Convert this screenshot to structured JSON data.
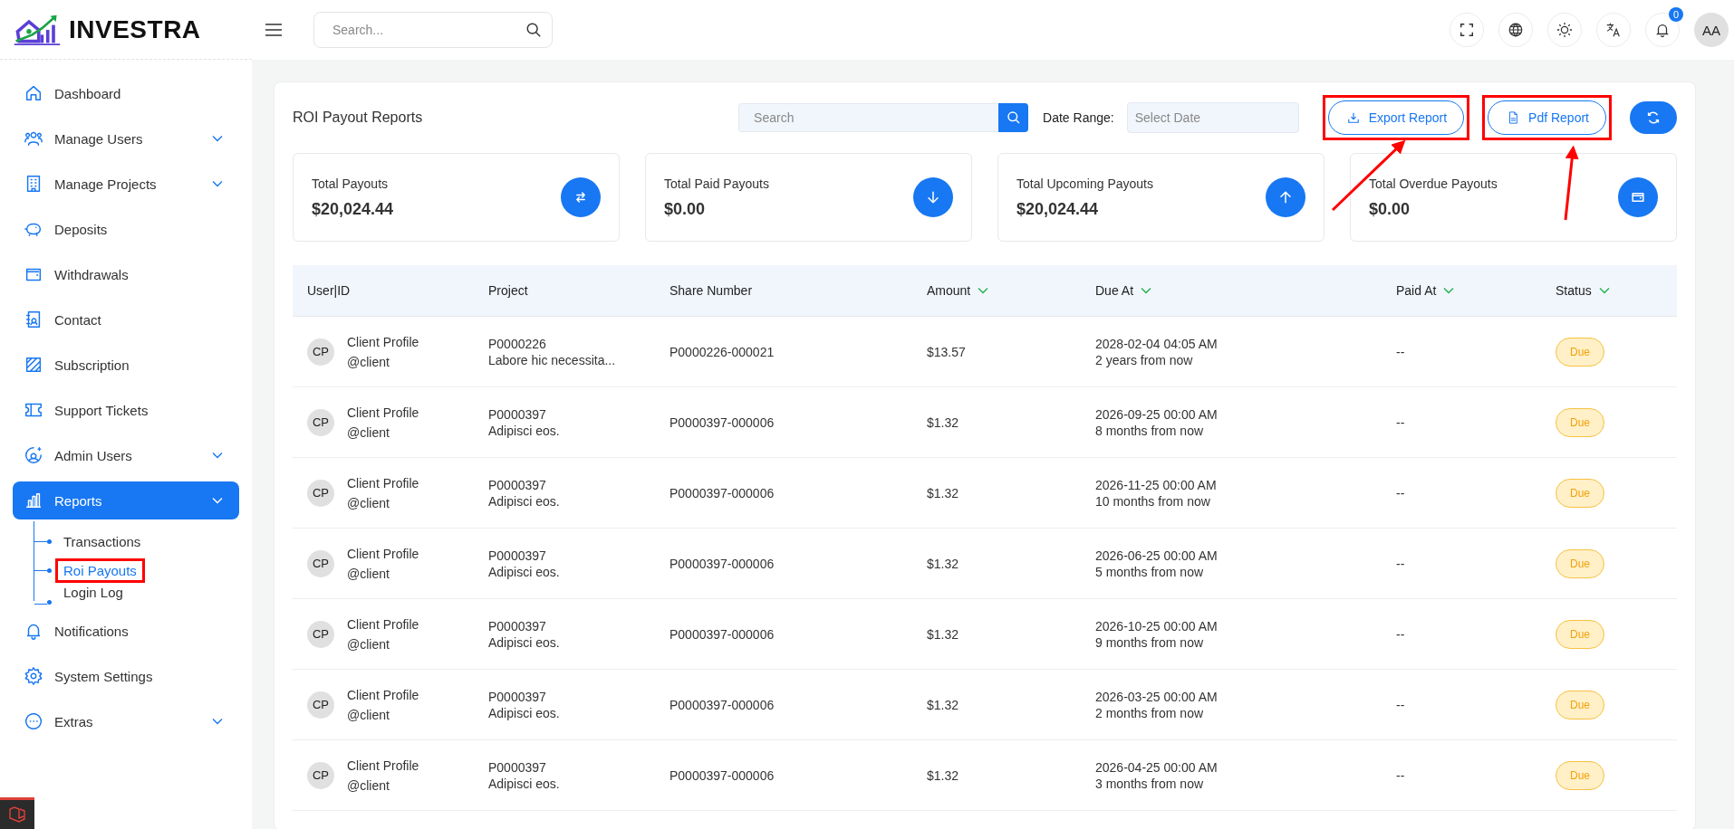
{
  "brand": {
    "name": "INVESTRA"
  },
  "topbar": {
    "search": {
      "placeholder": "Search..."
    },
    "notifications": {
      "count": "0"
    },
    "avatar": {
      "initials": "AA"
    }
  },
  "sidebar": {
    "items": [
      {
        "label": "Dashboard",
        "expandable": false,
        "selected": false
      },
      {
        "label": "Manage Users",
        "expandable": true,
        "selected": false
      },
      {
        "label": "Manage Projects",
        "expandable": true,
        "selected": false
      },
      {
        "label": "Deposits",
        "expandable": false,
        "selected": false
      },
      {
        "label": "Withdrawals",
        "expandable": false,
        "selected": false
      },
      {
        "label": "Contact",
        "expandable": false,
        "selected": false
      },
      {
        "label": "Subscription",
        "expandable": false,
        "selected": false
      },
      {
        "label": "Support Tickets",
        "expandable": false,
        "selected": false
      },
      {
        "label": "Admin Users",
        "expandable": true,
        "selected": false
      },
      {
        "label": "Reports",
        "expandable": true,
        "selected": true,
        "children": [
          {
            "label": "Transactions",
            "selected": false,
            "highlighted": false
          },
          {
            "label": "Roi Payouts",
            "selected": true,
            "highlighted": true
          },
          {
            "label": "Login Log",
            "selected": false,
            "highlighted": false
          }
        ]
      },
      {
        "label": "Notifications",
        "expandable": false,
        "selected": false
      },
      {
        "label": "System Settings",
        "expandable": false,
        "selected": false
      },
      {
        "label": "Extras",
        "expandable": true,
        "selected": false
      }
    ]
  },
  "page": {
    "title": "ROI Payout Reports",
    "search": {
      "placeholder": "Search"
    },
    "date_range": {
      "label": "Date Range:",
      "placeholder": "Select Date"
    },
    "buttons": [
      {
        "label": "Export Report",
        "highlighted": true
      },
      {
        "label": "Pdf Report",
        "highlighted": true
      }
    ],
    "stats": [
      {
        "label": "Total Payouts",
        "value": "$20,024.44"
      },
      {
        "label": "Total Paid Payouts",
        "value": "$0.00"
      },
      {
        "label": "Total Upcoming Payouts",
        "value": "$20,024.44"
      },
      {
        "label": "Total Overdue Payouts",
        "value": "$0.00"
      }
    ]
  },
  "table": {
    "columns": [
      {
        "label": "User|ID",
        "sortable": false
      },
      {
        "label": "Project",
        "sortable": false
      },
      {
        "label": "Share Number",
        "sortable": false
      },
      {
        "label": "Amount",
        "sortable": true
      },
      {
        "label": "Due At",
        "sortable": true
      },
      {
        "label": "Paid At",
        "sortable": true
      },
      {
        "label": "Status",
        "sortable": true
      }
    ],
    "rows": [
      {
        "initials": "CP",
        "name": "Client Profile",
        "username": "@client",
        "project_code": "P0000226",
        "project_name": "Labore hic necessita...",
        "share_number": "P0000226-000021",
        "amount": "$13.57",
        "due_at": "2028-02-04 04:05 AM",
        "due_relative": "2 years from now",
        "paid_at": "--",
        "status": "Due"
      },
      {
        "initials": "CP",
        "name": "Client Profile",
        "username": "@client",
        "project_code": "P0000397",
        "project_name": "Adipisci eos.",
        "share_number": "P0000397-000006",
        "amount": "$1.32",
        "due_at": "2026-09-25 00:00 AM",
        "due_relative": "8 months from now",
        "paid_at": "--",
        "status": "Due"
      },
      {
        "initials": "CP",
        "name": "Client Profile",
        "username": "@client",
        "project_code": "P0000397",
        "project_name": "Adipisci eos.",
        "share_number": "P0000397-000006",
        "amount": "$1.32",
        "due_at": "2026-11-25 00:00 AM",
        "due_relative": "10 months from now",
        "paid_at": "--",
        "status": "Due"
      },
      {
        "initials": "CP",
        "name": "Client Profile",
        "username": "@client",
        "project_code": "P0000397",
        "project_name": "Adipisci eos.",
        "share_number": "P0000397-000006",
        "amount": "$1.32",
        "due_at": "2026-06-25 00:00 AM",
        "due_relative": "5 months from now",
        "paid_at": "--",
        "status": "Due"
      },
      {
        "initials": "CP",
        "name": "Client Profile",
        "username": "@client",
        "project_code": "P0000397",
        "project_name": "Adipisci eos.",
        "share_number": "P0000397-000006",
        "amount": "$1.32",
        "due_at": "2026-10-25 00:00 AM",
        "due_relative": "9 months from now",
        "paid_at": "--",
        "status": "Due"
      },
      {
        "initials": "CP",
        "name": "Client Profile",
        "username": "@client",
        "project_code": "P0000397",
        "project_name": "Adipisci eos.",
        "share_number": "P0000397-000006",
        "amount": "$1.32",
        "due_at": "2026-03-25 00:00 AM",
        "due_relative": "2 months from now",
        "paid_at": "--",
        "status": "Due"
      },
      {
        "initials": "CP",
        "name": "Client Profile",
        "username": "@client",
        "project_code": "P0000397",
        "project_name": "Adipisci eos.",
        "share_number": "P0000397-000006",
        "amount": "$1.32",
        "due_at": "2026-04-25 00:00 AM",
        "due_relative": "3 months from now",
        "paid_at": "--",
        "status": "Due"
      }
    ]
  }
}
